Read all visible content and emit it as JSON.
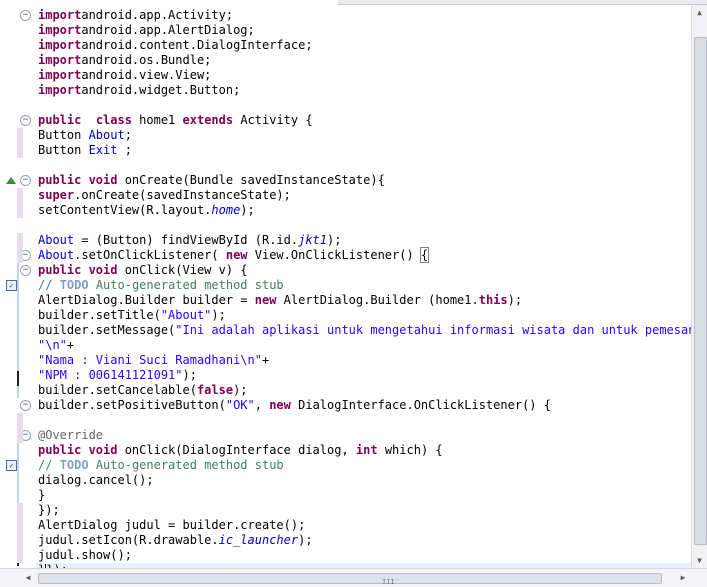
{
  "editor": {
    "lines": [
      {
        "tokens": [
          [
            "k",
            "import"
          ],
          [
            "",
            "android.app.Activity;"
          ]
        ]
      },
      {
        "tokens": [
          [
            "k",
            "import"
          ],
          [
            "",
            "android.app.AlertDialog;"
          ]
        ]
      },
      {
        "tokens": [
          [
            "k",
            "import"
          ],
          [
            "",
            "android.content.DialogInterface;"
          ]
        ]
      },
      {
        "tokens": [
          [
            "k",
            "import"
          ],
          [
            "",
            "android.os.Bundle;"
          ]
        ]
      },
      {
        "tokens": [
          [
            "k",
            "import"
          ],
          [
            "",
            "android.view.View;"
          ]
        ]
      },
      {
        "tokens": [
          [
            "k",
            "import"
          ],
          [
            "",
            "android.widget.Button;"
          ]
        ]
      },
      {
        "tokens": []
      },
      {
        "tokens": [
          [
            "k",
            "public"
          ],
          [
            "",
            "  "
          ],
          [
            "k",
            "class"
          ],
          [
            "",
            " home1 "
          ],
          [
            "k",
            "extends"
          ],
          [
            "",
            " Activity {"
          ]
        ]
      },
      {
        "tokens": [
          [
            "",
            "Button "
          ],
          [
            "f",
            "About"
          ],
          [
            "",
            ";"
          ]
        ]
      },
      {
        "tokens": [
          [
            "",
            "Button "
          ],
          [
            "f",
            "Exit"
          ],
          [
            "",
            " ;"
          ]
        ]
      },
      {
        "tokens": []
      },
      {
        "tokens": [
          [
            "k",
            "public"
          ],
          [
            "",
            ""
          ],
          [
            "k",
            " void"
          ],
          [
            "",
            " onCreate(Bundle savedInstanceState){"
          ]
        ]
      },
      {
        "tokens": [
          [
            "k",
            "super"
          ],
          [
            "",
            ".onCreate(savedInstanceState);"
          ]
        ]
      },
      {
        "tokens": [
          [
            "",
            "setContentView(R.layout."
          ],
          [
            "fi",
            "home"
          ],
          [
            "",
            ");"
          ]
        ]
      },
      {
        "tokens": []
      },
      {
        "tokens": [
          [
            "f",
            "About"
          ],
          [
            "",
            " = (Button) findViewById (R.id."
          ],
          [
            "fi",
            "jkt1"
          ],
          [
            "",
            ");"
          ]
        ]
      },
      {
        "tokens": [
          [
            "f",
            "About"
          ],
          [
            "",
            ".setOnClickListener( "
          ],
          [
            "k",
            "new"
          ],
          [
            "",
            " View.OnClickListener() "
          ],
          [
            "b",
            "{"
          ]
        ]
      },
      {
        "tokens": [
          [
            "k",
            "public"
          ],
          [
            "",
            ""
          ],
          [
            "k",
            " void"
          ],
          [
            "",
            " onClick(View v) {"
          ]
        ]
      },
      {
        "tokens": [
          [
            "c",
            "// "
          ],
          [
            "t",
            "TODO"
          ],
          [
            "c",
            " Auto-generated method stub"
          ]
        ]
      },
      {
        "tokens": [
          [
            "",
            "AlertDialog.Builder builder = "
          ],
          [
            "k",
            "new"
          ],
          [
            "",
            " AlertDialog.Builder (home1."
          ],
          [
            "k",
            "this"
          ],
          [
            "",
            ");"
          ]
        ]
      },
      {
        "tokens": [
          [
            "",
            "builder.setTitle("
          ],
          [
            "s",
            "\"About\""
          ],
          [
            "",
            ");"
          ]
        ]
      },
      {
        "tokens": [
          [
            "",
            "builder.setMessage("
          ],
          [
            "s",
            "\"Ini adalah aplikasi untuk mengetahui informasi wisata dan untuk pemesanan t"
          ]
        ]
      },
      {
        "tokens": [
          [
            "s",
            "\"\\n\""
          ],
          [
            "",
            "+"
          ]
        ]
      },
      {
        "tokens": [
          [
            "s",
            "\"Nama : Viani Suci Ramadhani\\n\""
          ],
          [
            "",
            "+"
          ]
        ]
      },
      {
        "tokens": [
          [
            "s",
            "\"NPM : 006141121091\""
          ],
          [
            "",
            ");"
          ]
        ]
      },
      {
        "tokens": [
          [
            "",
            "builder.setCancelable("
          ],
          [
            "k",
            "false"
          ],
          [
            "",
            ");"
          ]
        ]
      },
      {
        "tokens": [
          [
            "",
            "builder.setPositiveButton("
          ],
          [
            "s",
            "\"OK\""
          ],
          [
            "",
            ", "
          ],
          [
            "k",
            "new"
          ],
          [
            "",
            " DialogInterface.OnClickListener() {"
          ]
        ]
      },
      {
        "tokens": []
      },
      {
        "tokens": [
          [
            "a",
            "@Override"
          ]
        ]
      },
      {
        "tokens": [
          [
            "k",
            "public"
          ],
          [
            "",
            ""
          ],
          [
            "k",
            " void"
          ],
          [
            "",
            " onClick(DialogInterface dialog, "
          ],
          [
            "k",
            "int"
          ],
          [
            "",
            " which) {"
          ]
        ]
      },
      {
        "tokens": [
          [
            "c",
            "// "
          ],
          [
            "t",
            "TODO"
          ],
          [
            "c",
            " Auto-generated method stub"
          ]
        ]
      },
      {
        "tokens": [
          [
            "",
            "dialog.cancel();"
          ]
        ]
      },
      {
        "tokens": [
          [
            "",
            "}"
          ]
        ]
      },
      {
        "tokens": [
          [
            "",
            "});"
          ]
        ]
      },
      {
        "tokens": [
          [
            "",
            "AlertDialog judul = builder.create();"
          ]
        ]
      },
      {
        "tokens": [
          [
            "",
            "judul.setIcon(R.drawable."
          ],
          [
            "fi",
            "ic_launcher"
          ],
          [
            "",
            ");"
          ]
        ]
      },
      {
        "tokens": [
          [
            "",
            "judul.show();"
          ]
        ]
      },
      {
        "tokens": [
          [
            "",
            "}"
          ],
          [
            "caret",
            ""
          ],
          [
            "",
            "});"
          ]
        ]
      }
    ],
    "current_line": 37
  },
  "gutter": {
    "fold_icons": [
      {
        "line": 1,
        "glyph": "⊖",
        "name": "fold-collapse-icon"
      },
      {
        "line": 8,
        "glyph": "⊖",
        "name": "fold-collapse-icon"
      },
      {
        "line": 12,
        "glyph": "⊖",
        "name": "fold-collapse-icon"
      },
      {
        "line": 17,
        "glyph": "⊖",
        "name": "fold-collapse-icon"
      },
      {
        "line": 18,
        "glyph": "⊖",
        "name": "fold-collapse-icon"
      },
      {
        "line": 27,
        "glyph": "⊖",
        "name": "fold-collapse-icon"
      },
      {
        "line": 29,
        "glyph": "⊖",
        "name": "fold-collapse-icon"
      }
    ],
    "override_icon_line": 12,
    "task_icon_lines": [
      19,
      31
    ]
  },
  "scrollbars": {
    "vertical_up_glyph": "▲",
    "vertical_down_glyph": "▼",
    "horizontal_left_glyph": "◀",
    "horizontal_right_glyph": "▶",
    "horizontal_grip": "III"
  }
}
